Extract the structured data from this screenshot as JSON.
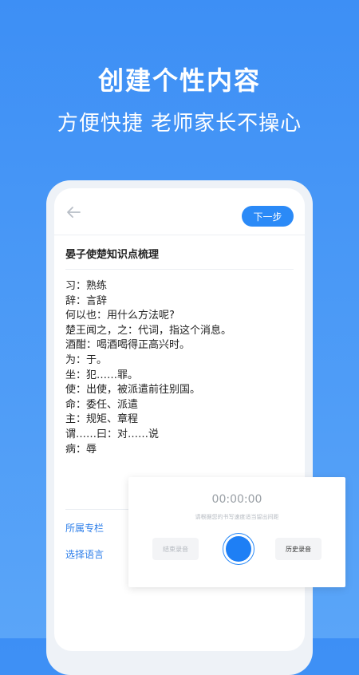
{
  "promo": {
    "headline": "创建个性内容",
    "subline": "方便快捷 老师家长不操心"
  },
  "editor": {
    "next_label": "下一步",
    "doc_title": "晏子使楚知识点梳理",
    "lines": [
      "习：熟练",
      "辞：言辞",
      "何以也：用什么方法呢?",
      "楚王闻之，之：代词，指这个消息。",
      "酒酣：喝酒喝得正高兴时。",
      "为：于。",
      "坐：犯……罪。",
      "使：出使，被派遣前往别国。",
      "命：委任、派遣",
      "主：规矩、章程",
      "谓……曰：对……说",
      "病：辱"
    ],
    "column_label": "所属专栏",
    "language_label": "选择语言"
  },
  "recorder": {
    "timer": "00:00:00",
    "hint": "请根据您的书写速度适当留出间距",
    "stop_label": "结束录音",
    "history_label": "历史录音"
  },
  "colors": {
    "accent": "#2b8af7",
    "link": "#2b7de9",
    "background_top": "#3d8ff5",
    "background_bottom": "#5aa5f8"
  },
  "icons": {
    "back": "arrow-left-icon",
    "record": "record-icon"
  }
}
